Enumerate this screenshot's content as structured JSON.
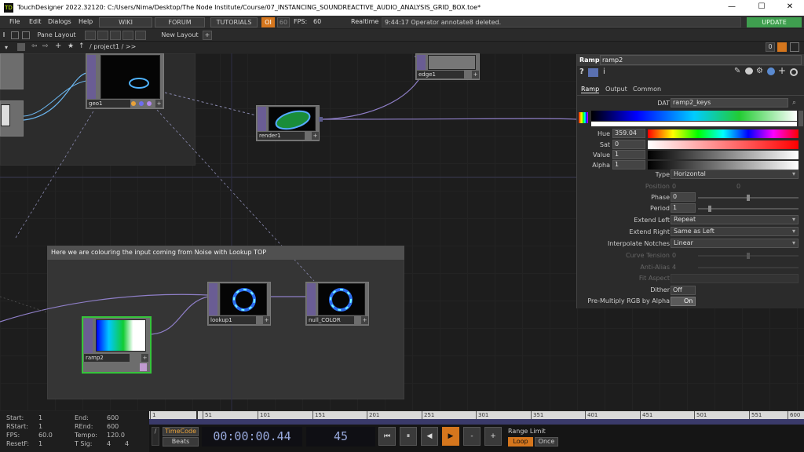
{
  "window": {
    "title": "TouchDesigner 2022.32120: C:/Users/Nima/Desktop/The Node Institute/Course/07_INSTANCING_SOUNDREACTIVE_AUDIO_ANALYSIS_GRID_BOX.toe*",
    "app_icon_text": "TD",
    "minimize": "—",
    "maximize": "☐",
    "close": "✕"
  },
  "menu": {
    "items": [
      "File",
      "Edit",
      "Dialogs",
      "Help"
    ],
    "wiki": "WIKI",
    "forum": "FORUM",
    "tutorials": "TUTORIALS",
    "oi": "OI",
    "fps_target": "60",
    "fps_label": "FPS:",
    "fps_value": "60",
    "realtime_label": "Realtime",
    "status_message": "9:44:17 Operator annotate8 deleted.",
    "update": "UPDATE"
  },
  "toolbar": {
    "pane_layout": "Pane Layout",
    "new_layout": "New Layout",
    "add": "+"
  },
  "pathbar": {
    "path": "/ project1 / >>",
    "pane_index": "0"
  },
  "network": {
    "annotation_title": "Here we are colouring the input coming from Noise with Lookup TOP",
    "nodes": {
      "geo1": "geo1",
      "render1": "render1",
      "edge1": "edge1",
      "lookup1": "lookup1",
      "null_color": "null_COLOR",
      "ramp2": "ramp2"
    }
  },
  "params": {
    "op_type": "Ramp",
    "op_name": "ramp2",
    "tabs": [
      "Ramp",
      "Output",
      "Common"
    ],
    "dat_label": "DAT",
    "dat_value": "ramp2_keys",
    "hue_label": "Hue",
    "hue_value": "359.04",
    "sat_label": "Sat",
    "sat_value": "0",
    "value_label": "Value",
    "value_value": "1",
    "alpha_label": "Alpha",
    "alpha_value": "1",
    "type_label": "Type",
    "type_value": "Horizontal",
    "position_label": "Position",
    "position_x": "0",
    "position_y": "0",
    "phase_label": "Phase",
    "phase_value": "0",
    "period_label": "Period",
    "period_value": "1",
    "extend_left_label": "Extend Left",
    "extend_left_value": "Repeat",
    "extend_right_label": "Extend Right",
    "extend_right_value": "Same as Left",
    "interp_label": "Interpolate Notches",
    "interp_value": "Linear",
    "curve_label": "Curve Tension",
    "curve_value": "0",
    "antialias_label": "Anti-Alias",
    "antialias_value": "4",
    "fitaspect_label": "Fit Aspect",
    "dither_label": "Dither",
    "dither_value": "Off",
    "premult_label": "Pre-Multiply RGB by Alpha",
    "premult_value": "On"
  },
  "timeline": {
    "start_label": "Start:",
    "start_value": "1",
    "rstart_label": "RStart:",
    "rstart_value": "1",
    "fps_label": "FPS:",
    "fps_value": "60.0",
    "resetf_label": "ResetF:",
    "resetf_value": "1",
    "end_label": "End:",
    "end_value": "600",
    "rend_label": "REnd:",
    "rend_value": "600",
    "tempo_label": "Tempo:",
    "tempo_value": "120.0",
    "tsig_label": "T Sig:",
    "tsig_a": "4",
    "tsig_b": "4",
    "ruler_ticks": [
      "1",
      "51",
      "101",
      "151",
      "201",
      "251",
      "301",
      "351",
      "401",
      "451",
      "501",
      "551",
      "600"
    ],
    "timecode_btn": "TimeCode",
    "beats_btn": "Beats",
    "timecode": "00:00:00.44",
    "frame": "45",
    "range_limit": "Range Limit",
    "loop": "Loop",
    "once": "Once",
    "transport": [
      "⏮",
      "⏸",
      "◀",
      "▶",
      "-",
      "+"
    ]
  }
}
